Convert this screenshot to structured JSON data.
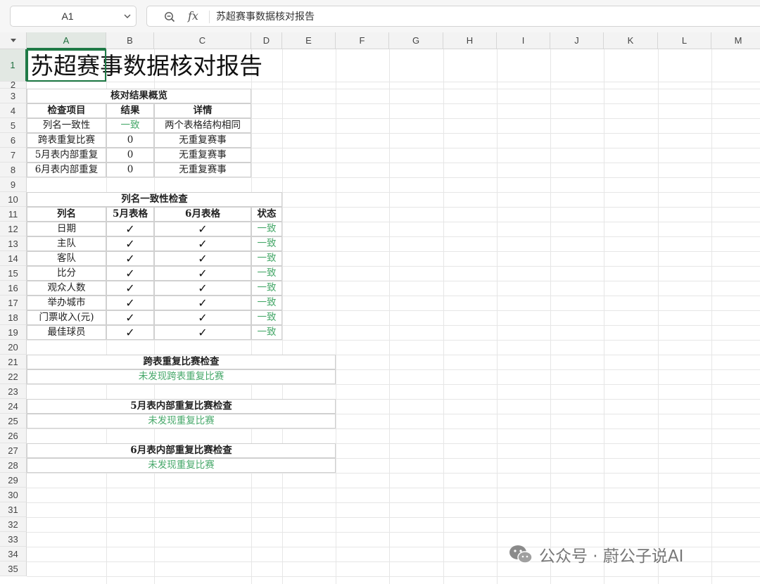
{
  "name_box": {
    "value": "A1"
  },
  "formula_bar": {
    "fx_label": "fx",
    "value": "苏超赛事数据核对报告"
  },
  "columns": [
    "A",
    "B",
    "C",
    "D",
    "E",
    "F",
    "G",
    "H",
    "I",
    "J",
    "K",
    "L",
    "M"
  ],
  "rows": [
    "1",
    "2",
    "3",
    "4",
    "5",
    "6",
    "7",
    "8",
    "9",
    "10",
    "11",
    "12",
    "13",
    "14",
    "15",
    "16",
    "17",
    "18",
    "19",
    "20",
    "21",
    "22",
    "23",
    "24",
    "25",
    "26",
    "27",
    "28",
    "29",
    "30",
    "31",
    "32",
    "33",
    "34",
    "35"
  ],
  "title": "苏超赛事数据核对报告",
  "overview": {
    "heading": "核对结果概览",
    "headers": [
      "检查项目",
      "结果",
      "详情"
    ],
    "rows": [
      [
        "列名一致性",
        "一致",
        "两个表格结构相同"
      ],
      [
        "跨表重复比赛",
        "0",
        "无重复赛事"
      ],
      [
        "5月表内部重复",
        "0",
        "无重复赛事"
      ],
      [
        "6月表内部重复",
        "0",
        "无重复赛事"
      ]
    ]
  },
  "column_check": {
    "heading": "列名一致性检查",
    "headers": [
      "列名",
      "5月表格",
      "6月表格",
      "状态"
    ],
    "check_mark": "✓",
    "status_text": "一致",
    "names": [
      "日期",
      "主队",
      "客队",
      "比分",
      "观众人数",
      "举办城市",
      "门票收入(元)",
      "最佳球员"
    ]
  },
  "cross_check": {
    "heading": "跨表重复比赛检查",
    "result": "未发现跨表重复比赛"
  },
  "may_check": {
    "heading": "5月表内部重复比赛检查",
    "result": "未发现重复比赛"
  },
  "june_check": {
    "heading": "6月表内部重复比赛检查",
    "result": "未发现重复比赛"
  },
  "watermark": {
    "text": "公众号 · 蔚公子说AI"
  },
  "colors": {
    "accent": "#1f7a46",
    "status_green": "#47a86a",
    "grid": "#e6e6e6"
  }
}
